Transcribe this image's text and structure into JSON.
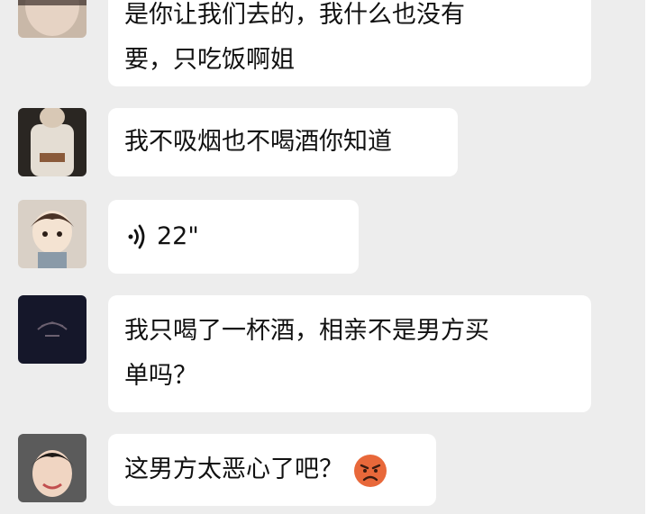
{
  "messages": [
    {
      "id": "m1",
      "type": "text",
      "avatar": "avatar-woman-partial",
      "lines": [
        "是你让我们去的，我什么也没有",
        "要，只吃饭啊姐"
      ]
    },
    {
      "id": "m2",
      "type": "text",
      "avatar": "avatar-man-shirt",
      "lines": [
        "我不吸烟也不喝酒你知道"
      ]
    },
    {
      "id": "m3",
      "type": "voice",
      "avatar": "avatar-cartoon-boy",
      "duration": "22\""
    },
    {
      "id": "m4",
      "type": "text",
      "avatar": "avatar-dark-logo",
      "lines": [
        "我只喝了一杯酒，相亲不是男方买",
        "单吗？"
      ]
    },
    {
      "id": "m5",
      "type": "text",
      "avatar": "avatar-child-photo",
      "lines": [
        "这男方太恶心了吧？"
      ],
      "emoji": "angry-face-emoji"
    }
  ],
  "colors": {
    "chat_background": "#ededed",
    "bubble": "#ffffff",
    "text": "#111111",
    "emoji": "#e8683a"
  }
}
